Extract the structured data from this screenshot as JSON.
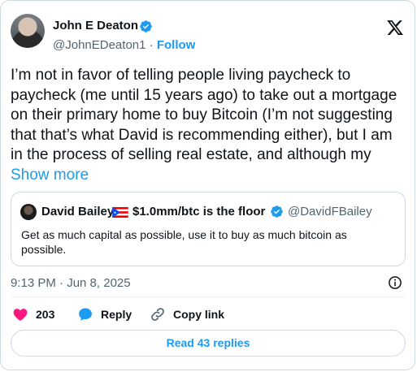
{
  "author": {
    "name": "John E Deaton",
    "handle": "@JohnEDeaton1",
    "separator": "·",
    "follow_label": "Follow"
  },
  "tweet": {
    "text": "I’m not in favor of telling people living paycheck to paycheck (me until 15 years ago) to take out a mortgage on their primary home to buy Bitcoin (I’m not suggesting that that’s what David is recommending either), but I am in the process of selling real estate, and although my",
    "show_more_label": "Show more"
  },
  "quote": {
    "name": "David Bailey",
    "name_suffix": "$1.0mm/btc is the floor",
    "handle": "@DavidFBailey",
    "text": "Get as much capital as possible, use it to buy as much bitcoin as possible."
  },
  "timestamp": "9:13 PM · Jun 8, 2025",
  "actions": {
    "likes_count": "203",
    "reply_label": "Reply",
    "copy_link_label": "Copy link"
  },
  "read_replies_label": "Read 43 replies",
  "colors": {
    "accent": "#1d9bf0",
    "like": "#f91880",
    "text": "#0f1419",
    "secondary": "#536471",
    "border": "#cfd9de"
  },
  "icons": [
    "verified-badge-icon",
    "x-logo-icon",
    "puerto-rico-flag-icon",
    "info-icon",
    "heart-icon",
    "reply-bubble-icon",
    "link-icon"
  ]
}
